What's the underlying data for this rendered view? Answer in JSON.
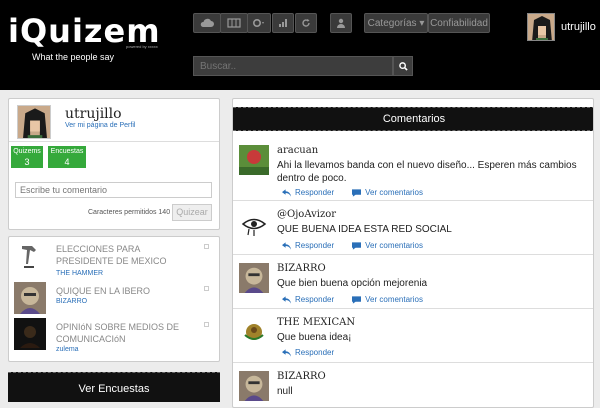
{
  "brand": {
    "logo_text": "iQuizem",
    "powered": "powered by xxxxx",
    "tagline": "What the people say"
  },
  "topbar": {
    "buttons": [
      "cloud-icon",
      "grid-icon",
      "gear-icon",
      "bar-chart-icon",
      "refresh-icon",
      "user-icon"
    ],
    "categorias_label": "Categorías ▾",
    "confiabilidad_label": "Confiabilidad",
    "search_placeholder": "Buscar..",
    "user_name": "utrujillo"
  },
  "profile": {
    "name": "utrujillo",
    "link": "Ver mi página de Perfil",
    "quizems_label": "Quizems",
    "quizems_count": "3",
    "encuestas_label": "Encuestas",
    "encuestas_count": "4",
    "comment_placeholder": "Escribe tu comentario",
    "chars_allowed": "Caracteres permitidos 140",
    "submit_label": "Quizear"
  },
  "surveys": [
    {
      "title": "ELECCIONES PARA PRESIDENTE DE MEXICO",
      "author": "THE HAMMER"
    },
    {
      "title": "QUIQUE EN LA IBERO",
      "author": "BIZARRO"
    },
    {
      "title": "OPINIóN SOBRE MEDIOS DE COMUNICACIóN",
      "author": "zulema"
    }
  ],
  "ver_encuestas": "Ver Encuestas",
  "comments": {
    "header": "Comentarios",
    "reply_label": "Responder",
    "view_label": "Ver comentarios",
    "items": [
      {
        "user": "aracuan",
        "text": "Ahi la llevamos banda con el nuevo diseño... Esperen más cambios dentro de poco."
      },
      {
        "user": "@OjoAvizor",
        "text": "QUE BUENA IDEA ESTA RED SOCIAL"
      },
      {
        "user": "BIZARRO",
        "text": "Que bien buena opción mejorenia"
      },
      {
        "user": "THE MEXICAN",
        "text": "Que buena idea¡"
      },
      {
        "user": "BIZARRO",
        "text": "null"
      }
    ]
  },
  "colors": {
    "accent_green": "#35a93b",
    "link_blue": "#2a6fb8",
    "bar_black": "#000000"
  }
}
